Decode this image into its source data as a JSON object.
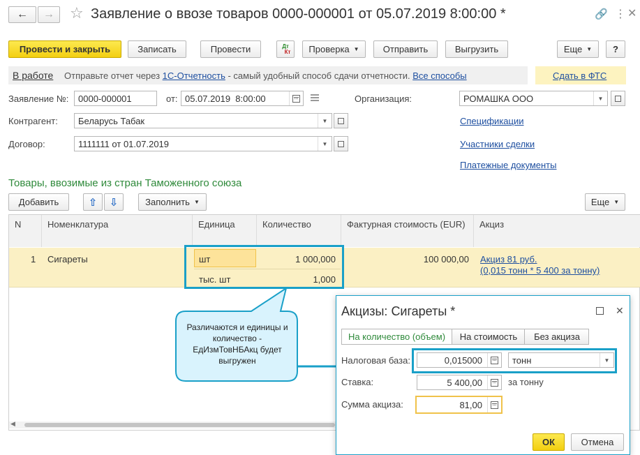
{
  "window": {
    "title": "Заявление о ввозе товаров 0000-000001 от 05.07.2019 8:00:00 *"
  },
  "toolbar": {
    "post_close": "Провести и закрыть",
    "save": "Записать",
    "post": "Провести",
    "dtkt_top": "Дт",
    "dtkt_bottom": "Кт",
    "check": "Проверка",
    "send": "Отправить",
    "unload": "Выгрузить",
    "more": "Еще",
    "help": "?"
  },
  "status_bar": {
    "status": "В работе",
    "text_before": "Отправьте отчет через ",
    "link_1c": "1С-Отчетность",
    "text_middle": " - самый удобный способ сдачи отчетности. ",
    "link_all": "Все способы",
    "fts_link": "Сдать в ФТС"
  },
  "form": {
    "number_label": "Заявление №:",
    "number_value": "0000-000001",
    "date_label": "от:",
    "date_value": "05.07.2019  8:00:00",
    "org_label": "Организация:",
    "org_value": "РОМАШКА ООО",
    "counterparty_label": "Контрагент:",
    "counterparty_value": "Беларусь Табак",
    "contract_label": "Договор:",
    "contract_value": "1111111 от 01.07.2019"
  },
  "side_links": {
    "specs": "Спецификации",
    "participants": "Участники сделки",
    "payments": "Платежные документы"
  },
  "goods": {
    "section_title": "Товары, ввозимые из стран Таможенного союза",
    "add": "Добавить",
    "fill": "Заполнить",
    "more": "Еще",
    "columns": [
      "N",
      "Номенклатура",
      "Единица",
      "Количество",
      "Фактурная стоимость (EUR)",
      "Акциз"
    ],
    "row": {
      "n": "1",
      "item": "Сигареты",
      "unit": "шт",
      "quantity": "1 000,000",
      "unit2": "тыс. шт",
      "quantity2": "1,000",
      "cost": "100 000,00",
      "excise_line1": "Акциз 81 руб.",
      "excise_line2": "(0,015 тонн * 5 400 за тонну)"
    }
  },
  "callout": {
    "text": "Различаются и единицы и количество - ЕдИзмТовНБАкц будет выгружен"
  },
  "dialog": {
    "title": "Акцизы: Сигареты *",
    "tabs": [
      "На количество (объем)",
      "На стоимость",
      "Без акциза"
    ],
    "tax_base_label": "Налоговая база:",
    "tax_base_value": "0,015000",
    "tax_base_unit": "тонн",
    "rate_label": "Ставка:",
    "rate_value": "5 400,00",
    "rate_suffix": "за тонну",
    "sum_label": "Сумма акциза:",
    "sum_value": "81,00",
    "ok": "ОК",
    "cancel": "Отмена"
  },
  "colors": {
    "primary_button": "#f5d31a",
    "highlight_row": "#fbf0c4",
    "callout_border": "#1aa0c8",
    "callout_fill": "#d9f3fd",
    "section_title": "#2f8a3b",
    "link": "#1e4fa0"
  }
}
